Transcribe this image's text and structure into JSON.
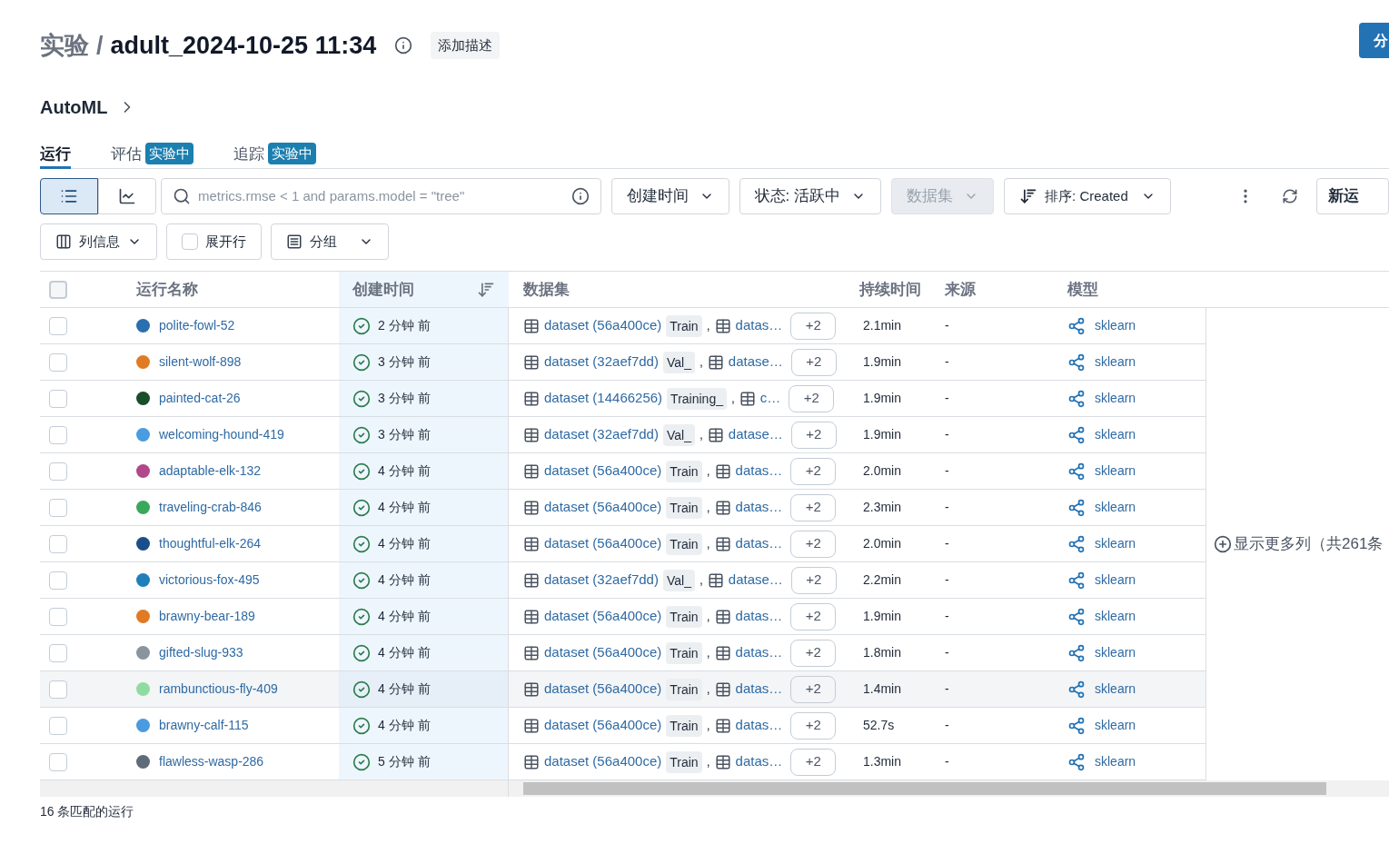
{
  "header": {
    "breadcrumb": "实验",
    "separator": "/",
    "title": "adult_2024-10-25 11:34",
    "add_description": "添加描述",
    "share_button": "分"
  },
  "section": {
    "title": "AutoML"
  },
  "tabs": [
    {
      "label": "运行",
      "selected": true
    },
    {
      "label": "评估",
      "badge": "实验中",
      "selected": false
    },
    {
      "label": "追踪",
      "badge": "实验中",
      "selected": false
    }
  ],
  "view_toggle": [
    {
      "kind": "list",
      "selected": true
    },
    {
      "kind": "chart",
      "selected": false
    }
  ],
  "search": {
    "placeholder": "metrics.rmse < 1 and params.model = \"tree\""
  },
  "filters": [
    {
      "label": "创建时间",
      "disabled": false
    },
    {
      "label": "状态: 活跃中",
      "disabled": false
    },
    {
      "label": "数据集",
      "disabled": true
    }
  ],
  "sort": {
    "label": "排序: Created"
  },
  "new_run_button": "新运",
  "options": [
    {
      "kind": "columns",
      "label": "列信息"
    },
    {
      "kind": "expand",
      "label": "展开行",
      "checked": false
    },
    {
      "kind": "group",
      "label": "分组"
    }
  ],
  "table": {
    "select_all_checked": false,
    "separator": ",",
    "columns": [
      "运行名称",
      "创建时间",
      "数据集",
      "持续时间",
      "来源",
      "模型"
    ],
    "rows": [
      {
        "name": "polite-fowl-52",
        "color": "#2a6fb0",
        "created": "2 分钟 前",
        "dataset": "dataset (56a400ce)",
        "tag": "Train",
        "dataset_2": "datas…",
        "more": "+2",
        "duration": "2.1min",
        "source": "-",
        "model": "sklearn",
        "selected": false
      },
      {
        "name": "silent-wolf-898",
        "color": "#e07b24",
        "created": "3 分钟 前",
        "dataset": "dataset (32aef7dd)",
        "tag": "Val_",
        "dataset_2": "datase…",
        "more": "+2",
        "duration": "1.9min",
        "source": "-",
        "model": "sklearn",
        "selected": false
      },
      {
        "name": "painted-cat-26",
        "color": "#1a4d2a",
        "created": "3 分钟 前",
        "dataset": "dataset (14466256)",
        "tag": "Training_",
        "dataset_2": "c…",
        "more": "+2",
        "duration": "1.9min",
        "source": "-",
        "model": "sklearn",
        "selected": false
      },
      {
        "name": "welcoming-hound-419",
        "color": "#4a9be0",
        "created": "3 分钟 前",
        "dataset": "dataset (32aef7dd)",
        "tag": "Val_",
        "dataset_2": "datase…",
        "more": "+2",
        "duration": "1.9min",
        "source": "-",
        "model": "sklearn",
        "selected": false
      },
      {
        "name": "adaptable-elk-132",
        "color": "#b0488a",
        "created": "4 分钟 前",
        "dataset": "dataset (56a400ce)",
        "tag": "Train",
        "dataset_2": "datas…",
        "more": "+2",
        "duration": "2.0min",
        "source": "-",
        "model": "sklearn",
        "selected": false
      },
      {
        "name": "traveling-crab-846",
        "color": "#3aa85a",
        "created": "4 分钟 前",
        "dataset": "dataset (56a400ce)",
        "tag": "Train",
        "dataset_2": "datas…",
        "more": "+2",
        "duration": "2.3min",
        "source": "-",
        "model": "sklearn",
        "selected": false
      },
      {
        "name": "thoughtful-elk-264",
        "color": "#1a4f8a",
        "created": "4 分钟 前",
        "dataset": "dataset (56a400ce)",
        "tag": "Train",
        "dataset_2": "datas…",
        "more": "+2",
        "duration": "2.0min",
        "source": "-",
        "model": "sklearn",
        "selected": false
      },
      {
        "name": "victorious-fox-495",
        "color": "#1f7fb8",
        "created": "4 分钟 前",
        "dataset": "dataset (32aef7dd)",
        "tag": "Val_",
        "dataset_2": "datase…",
        "more": "+2",
        "duration": "2.2min",
        "source": "-",
        "model": "sklearn",
        "selected": false
      },
      {
        "name": "brawny-bear-189",
        "color": "#e07b24",
        "created": "4 分钟 前",
        "dataset": "dataset (56a400ce)",
        "tag": "Train",
        "dataset_2": "datas…",
        "more": "+2",
        "duration": "1.9min",
        "source": "-",
        "model": "sklearn",
        "selected": false
      },
      {
        "name": "gifted-slug-933",
        "color": "#8a949e",
        "created": "4 分钟 前",
        "dataset": "dataset (56a400ce)",
        "tag": "Train",
        "dataset_2": "datas…",
        "more": "+2",
        "duration": "1.8min",
        "source": "-",
        "model": "sklearn",
        "selected": false
      },
      {
        "name": "rambunctious-fly-409",
        "color": "#8fdca0",
        "created": "4 分钟 前",
        "dataset": "dataset (56a400ce)",
        "tag": "Train",
        "dataset_2": "datas…",
        "more": "+2",
        "duration": "1.4min",
        "source": "-",
        "model": "sklearn",
        "selected": true
      },
      {
        "name": "brawny-calf-115",
        "color": "#4a9be0",
        "created": "4 分钟 前",
        "dataset": "dataset (56a400ce)",
        "tag": "Train",
        "dataset_2": "datas…",
        "more": "+2",
        "duration": "52.7s",
        "source": "-",
        "model": "sklearn",
        "selected": false
      },
      {
        "name": "flawless-wasp-286",
        "color": "#5f6b78",
        "created": "5 分钟 前",
        "dataset": "dataset (56a400ce)",
        "tag": "Train",
        "dataset_2": "datas…",
        "more": "+2",
        "duration": "1.3min",
        "source": "-",
        "model": "sklearn",
        "selected": false
      }
    ],
    "show_more_columns": "显示更多列（共261条"
  },
  "status_bar": "16 条匹配的运行"
}
